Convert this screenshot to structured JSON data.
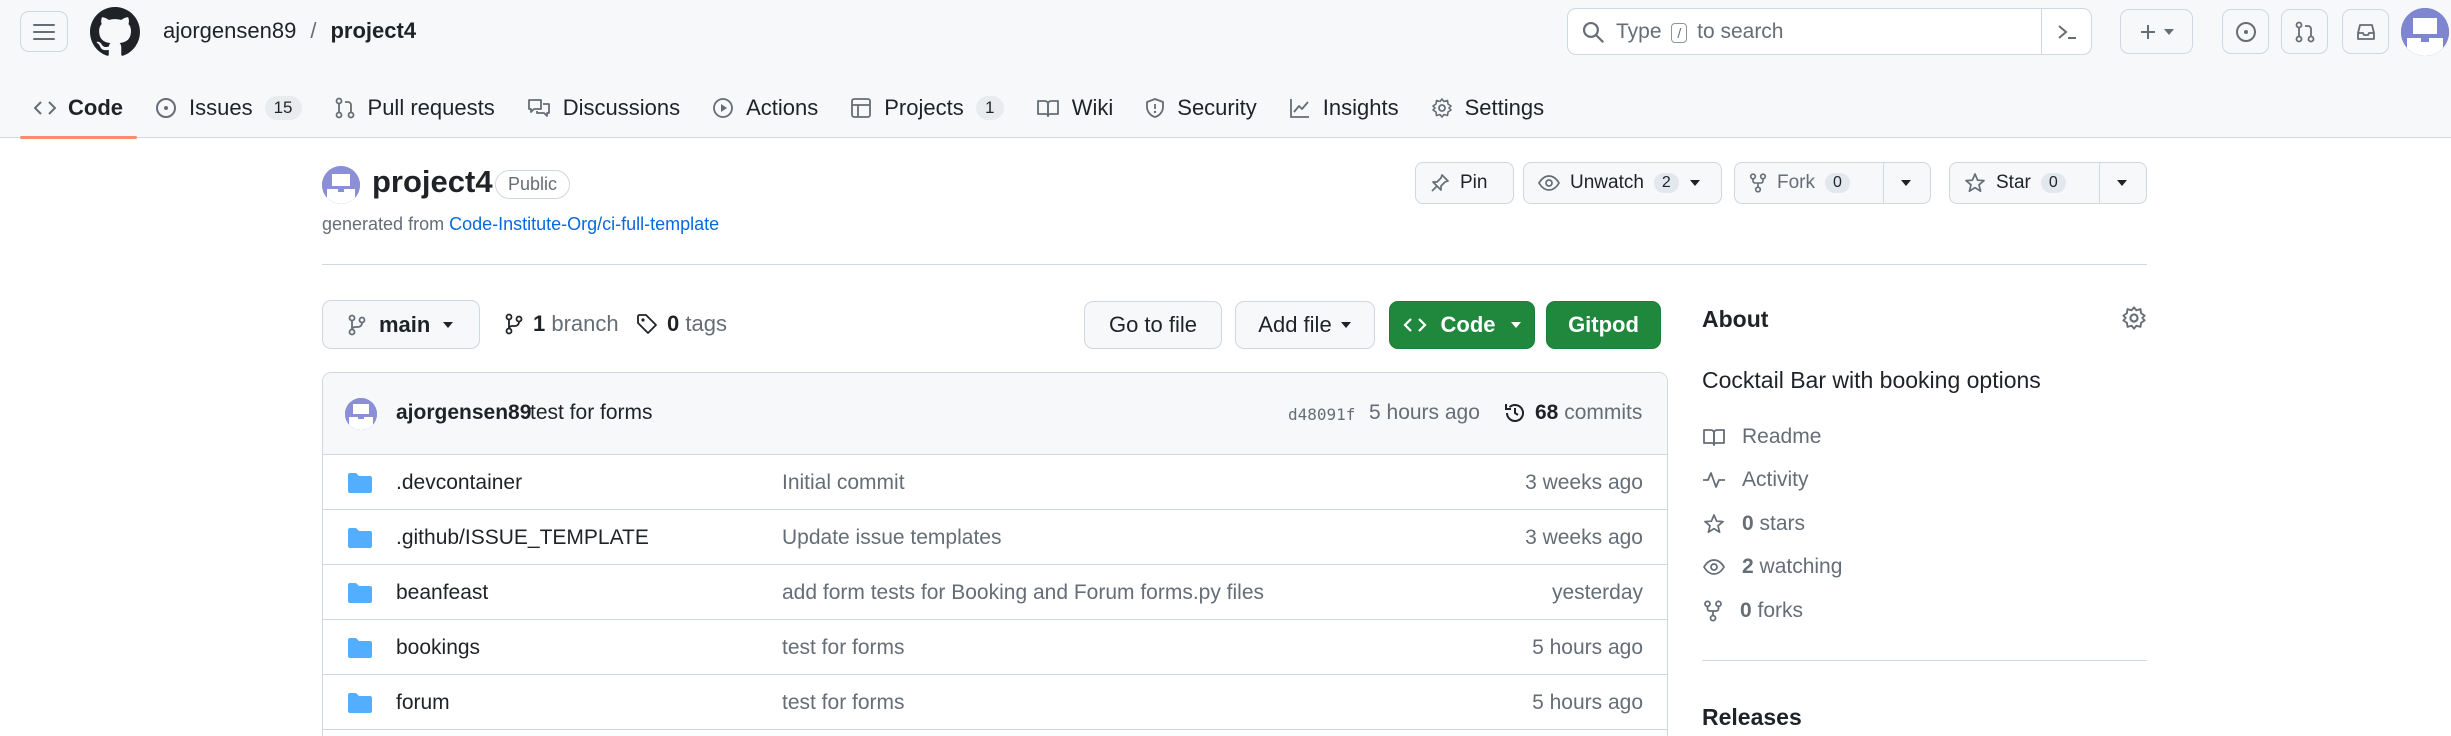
{
  "header": {
    "owner": "ajorgensen89",
    "separator": "/",
    "repo": "project4",
    "search_prefix": "Type",
    "search_key": "/",
    "search_suffix": "to search"
  },
  "nav": {
    "tabs": [
      {
        "label": "Code",
        "icon": "code-icon",
        "active": true
      },
      {
        "label": "Issues",
        "icon": "issue-opened-icon",
        "count": "15"
      },
      {
        "label": "Pull requests",
        "icon": "git-pull-request-icon"
      },
      {
        "label": "Discussions",
        "icon": "comment-discussion-icon"
      },
      {
        "label": "Actions",
        "icon": "play-icon"
      },
      {
        "label": "Projects",
        "icon": "table-icon",
        "count": "1"
      },
      {
        "label": "Wiki",
        "icon": "book-icon"
      },
      {
        "label": "Security",
        "icon": "shield-icon"
      },
      {
        "label": "Insights",
        "icon": "graph-icon"
      },
      {
        "label": "Settings",
        "icon": "gear-icon"
      }
    ]
  },
  "repo": {
    "name": "project4",
    "visibility": "Public",
    "generated_prefix": "generated from",
    "template_link": "Code-Institute-Org/ci-full-template",
    "pin_label": "Pin",
    "unwatch_label": "Unwatch",
    "unwatch_count": "2",
    "fork_label": "Fork",
    "fork_count": "0",
    "star_label": "Star",
    "star_count": "0"
  },
  "toolbar": {
    "branch": "main",
    "branch_count": "1",
    "branch_label": "branch",
    "tag_count": "0",
    "tag_label": "tags",
    "go_to_file": "Go to file",
    "add_file": "Add file",
    "code": "Code",
    "gitpod": "Gitpod"
  },
  "commit": {
    "author": "ajorgensen89",
    "message": "test for forms",
    "sha": "d48091f",
    "time": "5 hours ago",
    "count": "68",
    "count_label": "commits"
  },
  "files": [
    {
      "name": ".devcontainer",
      "message": "Initial commit",
      "time": "3 weeks ago"
    },
    {
      "name": ".github/ISSUE_TEMPLATE",
      "message": "Update issue templates",
      "time": "3 weeks ago"
    },
    {
      "name": "beanfeast",
      "message": "add form tests for Booking and Forum forms.py files",
      "time": "yesterday"
    },
    {
      "name": "bookings",
      "message": "test for forms",
      "time": "5 hours ago"
    },
    {
      "name": "forum",
      "message": "test for forms",
      "time": "5 hours ago"
    }
  ],
  "about": {
    "title": "About",
    "description": "Cocktail Bar with booking options",
    "readme": "Readme",
    "activity": "Activity",
    "stars_count": "0",
    "stars_label": "stars",
    "watching_count": "2",
    "watching_label": "watching",
    "forks_count": "0",
    "forks_label": "forks",
    "releases": "Releases"
  },
  "colors": {
    "accent_underline": "#fd8c73",
    "green_button": "#1f883d",
    "link": "#0969da",
    "folder": "#54aeff"
  }
}
